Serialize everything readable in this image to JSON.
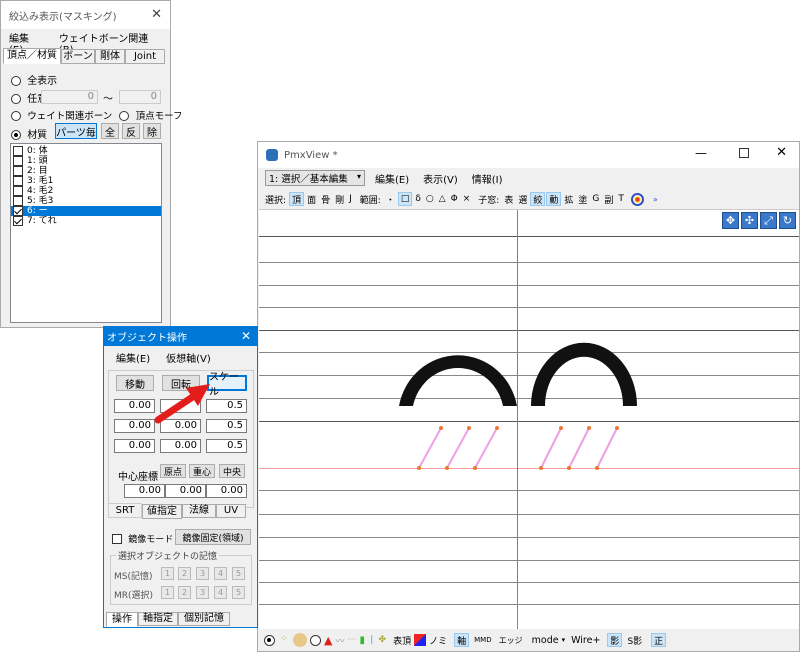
{
  "mask_window": {
    "title": "絞込み表示(マスキング)",
    "menu": [
      "編集(E)",
      "ウェイトボーン関連(B)"
    ],
    "tabs": [
      "頂点／材質",
      "ボーン",
      "剛体",
      "Joint"
    ],
    "opt_all": "全表示",
    "opt_any": "任意",
    "any_from": "0",
    "tilde": "〜",
    "any_to": "0",
    "opt_weight_bone": "ウェイト関連ボーン",
    "opt_vertex_morph": "頂点モーフ",
    "opt_material": "材質",
    "parts_button": "パーツ毎",
    "all_button": "全",
    "invert_button": "反",
    "remove_button": "除",
    "materials": [
      {
        "label": "0: 体",
        "checked": false,
        "selected": false
      },
      {
        "label": "1: 頭",
        "checked": false,
        "selected": false
      },
      {
        "label": "2: 目",
        "checked": false,
        "selected": false
      },
      {
        "label": "3: 毛1",
        "checked": false,
        "selected": false
      },
      {
        "label": "4: 毛2",
        "checked": false,
        "selected": false
      },
      {
        "label": "5: 毛3",
        "checked": false,
        "selected": false
      },
      {
        "label": "6: ー",
        "checked": true,
        "selected": true
      },
      {
        "label": "7: てれ",
        "checked": true,
        "selected": false
      }
    ]
  },
  "object_window": {
    "title": "オブジェクト操作",
    "menu": [
      "編集(E)",
      "仮想軸(V)"
    ],
    "move_button": "移動",
    "rotate_button": "回転",
    "scale_button": "スケール",
    "move_values": [
      "0.00",
      "0.00",
      "0.00"
    ],
    "rotate_values": [
      "",
      "0.00",
      "0.00"
    ],
    "scale_values": [
      "0.5",
      "0.5",
      "0.5"
    ],
    "center_label": "中心座標",
    "origin_button": "原点",
    "centroid_button": "重心",
    "middle_button": "中央",
    "center_values": [
      "0.00",
      "0.00",
      "0.00"
    ],
    "tabs1": [
      "SRT",
      "値指定",
      "法線",
      "UV"
    ],
    "mirror_mode": "鏡像モード",
    "mirror_fixed_button": "鏡像固定(領域)",
    "memory_title": "選択オブジェクトの記憶",
    "ms_label": "MS(記憶)",
    "mr_label": "MR(選択)",
    "memory_slots": [
      "1",
      "2",
      "3",
      "4",
      "5"
    ],
    "tabs2": [
      "操作",
      "軸指定",
      "個別記憶"
    ]
  },
  "pmx_window": {
    "title": "PmxView *",
    "mode_select": "1: 選択／基本編集",
    "menu": [
      "編集(E)",
      "表示(V)",
      "情報(I)"
    ],
    "tb_select_label": "選択:",
    "tb_select": [
      "頂",
      "面",
      "骨",
      "剛",
      "J"
    ],
    "tb_range_label": "範囲:",
    "tb_range": [
      "・",
      "□",
      "δ",
      "○",
      "△",
      "Φ",
      "×"
    ],
    "tb_child_label": "子窓:",
    "tb_child": [
      "表",
      "選",
      "絞",
      "動",
      "拡",
      "塗",
      "G",
      "副",
      "T"
    ],
    "bottom_text": [
      "表頂",
      "ノミ",
      "軸",
      "エッジ",
      "mode",
      "Wire+",
      "影",
      "S影",
      "正"
    ]
  },
  "colors": {
    "accent_red": "#e31c1c",
    "selection_blue": "#0078d7",
    "shape_black": "#111111",
    "blush_pink": "#f0a0e6",
    "blush_orange": "#f07830"
  }
}
